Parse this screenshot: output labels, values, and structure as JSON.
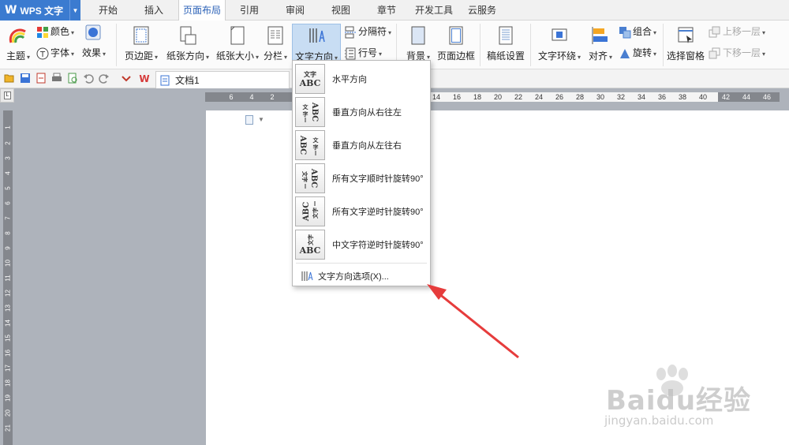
{
  "app": {
    "title": "WPS 文字"
  },
  "menu": {
    "tabs": [
      {
        "label": "开始"
      },
      {
        "label": "插入"
      },
      {
        "label": "页面布局"
      },
      {
        "label": "引用"
      },
      {
        "label": "审阅"
      },
      {
        "label": "视图"
      },
      {
        "label": "章节"
      },
      {
        "label": "开发工具"
      },
      {
        "label": "云服务"
      }
    ],
    "active_tab": "页面布局"
  },
  "ribbon": {
    "theme": "主题",
    "colors": "颜色",
    "font": "字体",
    "effects": "效果",
    "margins": "页边距",
    "orientation": "纸张方向",
    "size": "纸张大小",
    "columns": "分栏",
    "text_direction": "文字方向",
    "breaks": "分隔符",
    "line_numbers": "行号",
    "background": "背景",
    "page_border": "页面边框",
    "manuscript": "稿纸设置",
    "text_wrap": "文字环绕",
    "align": "对齐",
    "group": "组合",
    "rotate": "旋转",
    "selection_pane": "选择窗格",
    "bring_forward": "上移一层",
    "send_backward": "下移一层"
  },
  "document": {
    "tab_title": "文档1"
  },
  "ruler": {
    "h_ticks": [
      "6",
      "4",
      "2",
      "14",
      "16",
      "18",
      "20",
      "22",
      "24",
      "26",
      "28",
      "30",
      "32",
      "34",
      "36",
      "38",
      "40",
      "42",
      "44",
      "46"
    ],
    "v_ticks": [
      "1",
      "2",
      "3",
      "4",
      "5",
      "6",
      "7",
      "8",
      "9",
      "10",
      "11",
      "12",
      "13",
      "14",
      "15",
      "16",
      "17",
      "18",
      "19",
      "20",
      "21"
    ]
  },
  "text_direction_menu": {
    "items": [
      {
        "label": "水平方向",
        "icon": "horizontal-text-icon"
      },
      {
        "label": "垂直方向从右往左",
        "icon": "vertical-rtl-icon"
      },
      {
        "label": "垂直方向从左往右",
        "icon": "vertical-ltr-icon"
      },
      {
        "label": "所有文字顺时针旋转90°",
        "icon": "rotate-cw-icon"
      },
      {
        "label": "所有文字逆时针旋转90°",
        "icon": "rotate-ccw-icon"
      },
      {
        "label": "中文字符逆时针旋转90°",
        "icon": "cjk-rotate-ccw-icon"
      }
    ],
    "options": "文字方向选项(X)..."
  },
  "watermark": {
    "brand": "Baidu经验",
    "url": "jingyan.baidu.com"
  },
  "colors": {
    "accent": "#3b7bd0",
    "active_ribbon": "#c8ddf3",
    "arrow": "#e63c3c"
  }
}
